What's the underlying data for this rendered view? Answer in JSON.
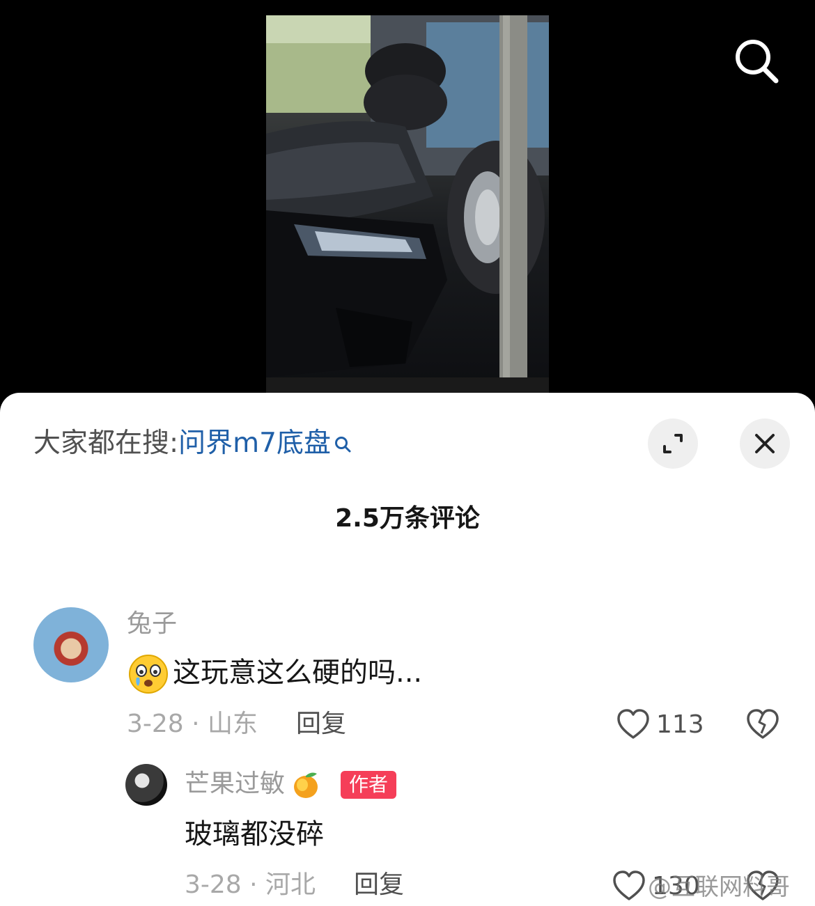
{
  "icons": {
    "top_search": "search-icon",
    "expand": "expand-icon",
    "close": "close-icon",
    "like": "heart-icon",
    "dislike": "broken-heart-icon",
    "emoji": "crying-face-emoji",
    "mango": "mango-emoji"
  },
  "hot_search": {
    "prefix": "大家都在搜:",
    "term": "问界m7底盘"
  },
  "comment_count": "2.5万条评论",
  "comments": [
    {
      "username": "兔子",
      "text": "这玩意这么硬的吗...",
      "date_location": "3-28 · 山东",
      "reply_label": "回复",
      "likes": "113"
    },
    {
      "username": "芒果过敏",
      "badge": "作者",
      "text": "玻璃都没碎",
      "date_location": "3-28 · 河北",
      "reply_label": "回复",
      "likes": "130"
    }
  ],
  "watermark": "@互联网料哥",
  "colors": {
    "accent_link": "#1f5fa8",
    "author_badge": "#f53e58",
    "sheet_bg": "#ffffff",
    "page_bg": "#000000"
  }
}
